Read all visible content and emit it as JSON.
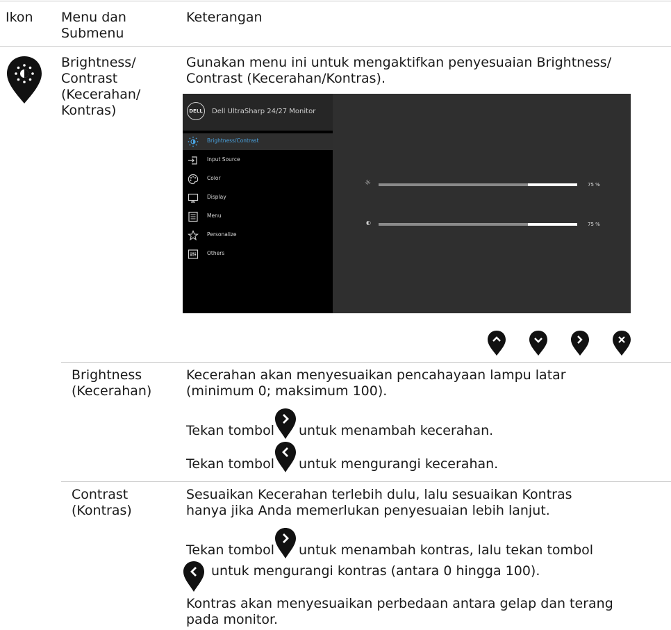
{
  "header": {
    "col_icon": "Ikon",
    "col_menu": "Menu dan\nSubmenu",
    "col_desc": "Keterangan"
  },
  "main_row": {
    "icon": "brightness-pin-icon",
    "menu": "Brightness/\nContrast\n(Kecerahan/\nKontras)",
    "desc": "Gunakan menu ini untuk mengaktifkan penyesuaian Brightness/\nContrast (Kecerahan/Kontras)."
  },
  "osd": {
    "logo": "DELL",
    "title": "Dell UltraSharp 24/27 Monitor",
    "items": [
      {
        "label": "Brightness/Contrast",
        "icon": "brightness-icon"
      },
      {
        "label": "Input Source",
        "icon": "input-source-icon"
      },
      {
        "label": "Color",
        "icon": "color-palette-icon"
      },
      {
        "label": "Display",
        "icon": "display-icon"
      },
      {
        "label": "Menu",
        "icon": "menu-icon"
      },
      {
        "label": "Personalize",
        "icon": "star-icon"
      },
      {
        "label": "Others",
        "icon": "others-icon"
      }
    ],
    "brightness": {
      "label": "75 %",
      "value": 0.75,
      "icon": "sun-icon"
    },
    "contrast": {
      "label": "75 %",
      "value": 0.75,
      "icon": "contrast-icon"
    },
    "selected_color": "#4aa3e0"
  },
  "nav_buttons": [
    "up-icon",
    "down-icon",
    "right-icon",
    "close-icon"
  ],
  "brightness_row": {
    "name": "Brightness\n(Kecerahan)",
    "desc": "Kecerahan akan menyesuaikan pencahayaan lampu latar\n(minimum 0; maksimum 100).",
    "inc_pre": "Tekan tombol",
    "inc_post": "untuk menambah kecerahan.",
    "dec_pre": "Tekan tombol",
    "dec_post": "untuk mengurangi kecerahan."
  },
  "contrast_row": {
    "name": "Contrast\n(Kontras)",
    "desc": "Sesuaikan Kecerahan terlebih dulu, lalu sesuaikan Kontras\nhanya jika Anda memerlukan penyesuaian lebih lanjut.",
    "inc_pre": "Tekan tombol",
    "inc_post": "untuk menambah kontras, lalu tekan tombol",
    "dec_post": "untuk mengurangi kontras (antara 0 hingga 100).",
    "note": "Kontras akan menyesuaikan perbedaan antara gelap dan terang\npada monitor."
  }
}
